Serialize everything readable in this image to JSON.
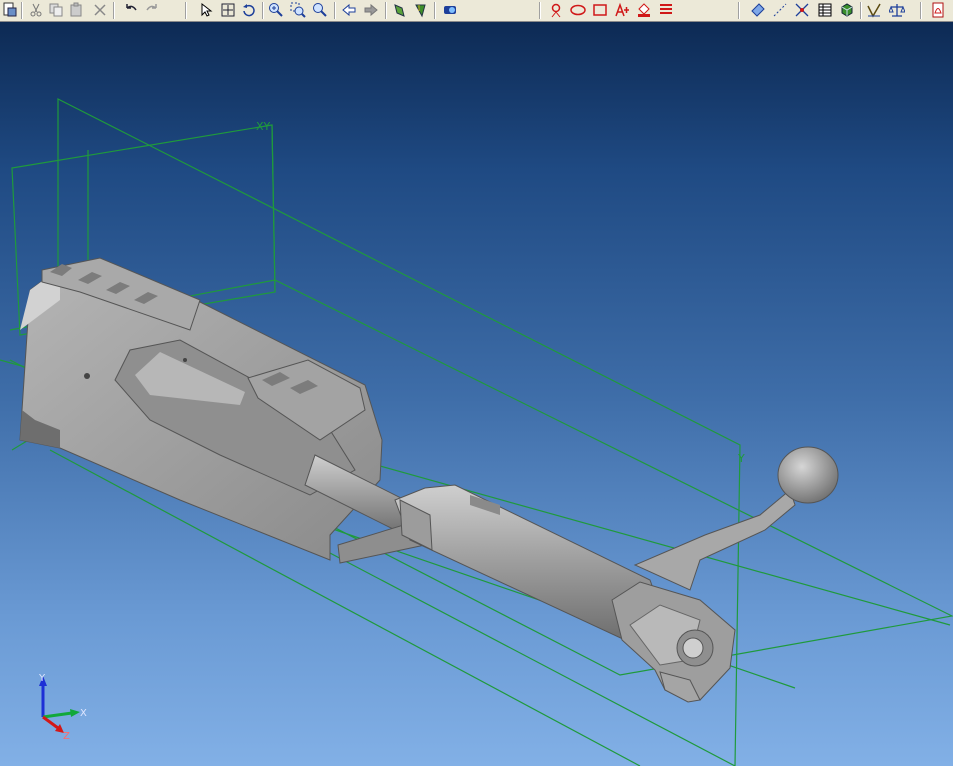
{
  "toolbar": {
    "groups": [
      [
        "new-sketch",
        "cut",
        "copy",
        "paste",
        "delete"
      ],
      [
        "undo",
        "redo"
      ],
      [
        "select",
        "zoom-box",
        "rotate-view"
      ],
      [
        "zoom-in",
        "zoom-area",
        "zoom-fit"
      ],
      [
        "previous-view",
        "next-view"
      ],
      [
        "shaded-view",
        "normal-view"
      ],
      [
        "render"
      ],
      [
        "sketch-point",
        "ellipse",
        "rectangle",
        "text",
        "fill",
        "line-style"
      ],
      [
        "plane",
        "line",
        "intersect",
        "table",
        "part",
        "measure",
        "mass-properties"
      ],
      [
        "export-pdf"
      ]
    ]
  },
  "scene": {
    "plane_label_xy": "XY",
    "plane_label_yz": "Y",
    "triad": {
      "y": "Y",
      "x": "X",
      "z": "Z"
    }
  },
  "colors": {
    "bg_top": "#0d2a54",
    "bg_bottom": "#82b0e6",
    "plane_lines": "#1f9a3c",
    "part_gray": "#9a9a9a"
  }
}
